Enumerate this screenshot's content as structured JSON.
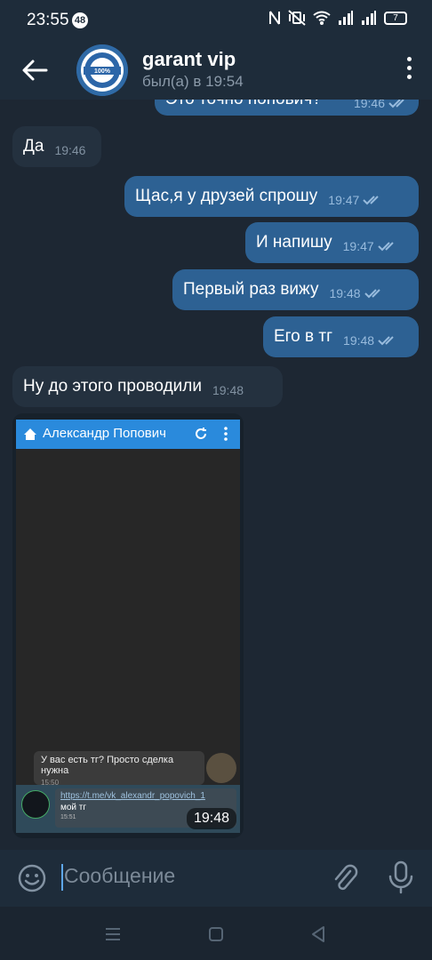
{
  "status_bar": {
    "time": "23:55",
    "notification_count": "48",
    "battery_level": "7"
  },
  "header": {
    "title": "garant vip",
    "last_seen": "был(а) в 19:54",
    "avatar_icon": "guarantee-badge-icon"
  },
  "messages": [
    {
      "direction": "out",
      "text": "Это точно попович?",
      "time": "19:46",
      "read": true,
      "partially_visible": true
    },
    {
      "direction": "in",
      "text": "Да",
      "time": "19:46"
    },
    {
      "direction": "out",
      "text": "Щас,я у друзей спрошу",
      "time": "19:47",
      "read": true
    },
    {
      "direction": "out",
      "text": "И напишу",
      "time": "19:47",
      "read": true
    },
    {
      "direction": "out",
      "text": "Первый раз вижу",
      "time": "19:48",
      "read": true
    },
    {
      "direction": "out",
      "text": "Его в тг",
      "time": "19:48",
      "read": true
    },
    {
      "direction": "in",
      "text": "Ну до этого проводили",
      "time": "19:48"
    }
  ],
  "media_message": {
    "time": "19:48",
    "screenshot": {
      "header_title": "Александр Попович",
      "inner_message_text": "У вас есть тг? Просто сделка нужна",
      "inner_message_time": "15:50",
      "link": "https://t.me/vk_alexandr_popovich_1",
      "link_caption": "мой тг",
      "link_time": "15:51"
    }
  },
  "input": {
    "placeholder": "Сообщение"
  },
  "colors": {
    "background": "#1d2733",
    "incoming_bubble": "#24313f",
    "outgoing_bubble": "#2d6193",
    "accent": "#5ea7e8"
  }
}
